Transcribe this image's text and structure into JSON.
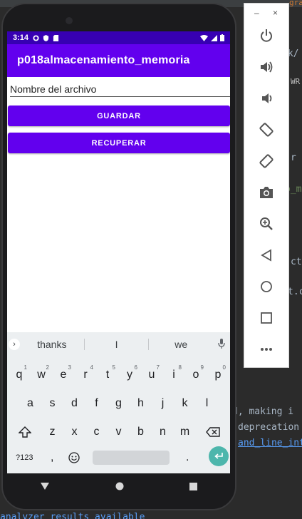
{
  "ide": {
    "tab_fragment": "gra",
    "code_fragments": [
      {
        "text": "ok/",
        "class": ""
      },
      {
        "text": "WR",
        "class": ""
      },
      {
        "text": "r",
        "class": ""
      },
      {
        "text": "o_m",
        "class": ""
      },
      {
        "text": "ct",
        "class": ""
      },
      {
        "text": "t.c",
        "class": ""
      }
    ],
    "console_lines": [
      {
        "text": "d, making i",
        "link": false
      },
      {
        "text": "deprecation",
        "link": false
      },
      {
        "text": "and_line_int",
        "link": true
      }
    ],
    "bottom_status": "analyzer results available"
  },
  "status_bar": {
    "time": "3:14",
    "left_icons": [
      "gear-icon",
      "shield-icon",
      "sd-card-icon"
    ],
    "right_icons": [
      "wifi-icon",
      "signal-icon",
      "battery-icon"
    ]
  },
  "app_bar": {
    "title": "p018almacenamiento_memoria",
    "color": "#6200ee",
    "status_color": "#3700b3"
  },
  "form": {
    "filename_placeholder": "Nombre del archivo",
    "save_label": "GUARDAR",
    "load_label": "RECUPERAR"
  },
  "keyboard": {
    "suggestions": [
      "thanks",
      "I",
      "we"
    ],
    "row1": [
      {
        "k": "q",
        "n": "1"
      },
      {
        "k": "w",
        "n": "2"
      },
      {
        "k": "e",
        "n": "3"
      },
      {
        "k": "r",
        "n": "4"
      },
      {
        "k": "t",
        "n": "5"
      },
      {
        "k": "y",
        "n": "6"
      },
      {
        "k": "u",
        "n": "7"
      },
      {
        "k": "i",
        "n": "8"
      },
      {
        "k": "o",
        "n": "9"
      },
      {
        "k": "p",
        "n": "0"
      }
    ],
    "row2": [
      "a",
      "s",
      "d",
      "f",
      "g",
      "h",
      "j",
      "k",
      "l"
    ],
    "row3": [
      "z",
      "x",
      "c",
      "v",
      "b",
      "n",
      "m"
    ],
    "symbols_label": "?123",
    "comma_label": ",",
    "period_label": "."
  },
  "emulator_panel": {
    "minimize_label": "–",
    "close_label": "×",
    "buttons": [
      "power-icon",
      "volume-up-icon",
      "volume-down-icon",
      "rotate-left-icon",
      "rotate-right-icon",
      "camera-icon",
      "zoom-icon",
      "back-icon",
      "home-icon",
      "overview-icon",
      "more-icon"
    ]
  }
}
